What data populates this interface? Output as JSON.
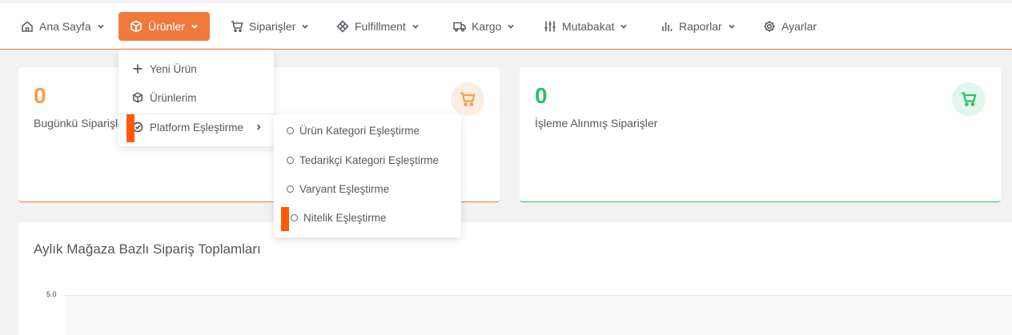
{
  "nav": {
    "items": [
      {
        "label": "Ana Sayfa",
        "icon": "home-icon"
      },
      {
        "label": "Ürünler",
        "icon": "box-icon",
        "active": true
      },
      {
        "label": "Siparişler",
        "icon": "cart-icon"
      },
      {
        "label": "Fulfillment",
        "icon": "package-icon"
      },
      {
        "label": "Kargo",
        "icon": "truck-icon"
      },
      {
        "label": "Mutabakat",
        "icon": "sliders-icon"
      },
      {
        "label": "Raporlar",
        "icon": "bar-chart-icon"
      },
      {
        "label": "Ayarlar",
        "icon": "gear-icon"
      }
    ],
    "accent": "#f07a3d"
  },
  "dropdown": {
    "items": [
      {
        "label": "Yeni Ürün",
        "icon": "plus-icon"
      },
      {
        "label": "Ürünlerim",
        "icon": "box-icon"
      },
      {
        "label": "Platform Eşleştirme",
        "icon": "check-circle-icon",
        "has_submenu": true
      }
    ]
  },
  "submenu": {
    "items": [
      {
        "label": "Ürün Kategori Eşleştirme"
      },
      {
        "label": "Tedarikçi Kategori Eşleştirme"
      },
      {
        "label": "Varyant Eşleştirme"
      },
      {
        "label": "Nitelik Eşleştirme"
      }
    ]
  },
  "cards": [
    {
      "value": "0",
      "label": "Bugünkü Siparişler",
      "color": "#f5a04b",
      "icon": "cart-icon"
    },
    {
      "value": "0",
      "label": "İşleme Alınmış Siparişler",
      "color": "#2ebd6b",
      "icon": "cart-icon"
    }
  ],
  "chart_data": {
    "type": "bar",
    "title": "Aylık Mağaza Bazlı Sipariş Toplamları",
    "y_ticks": [
      "5.0"
    ]
  }
}
